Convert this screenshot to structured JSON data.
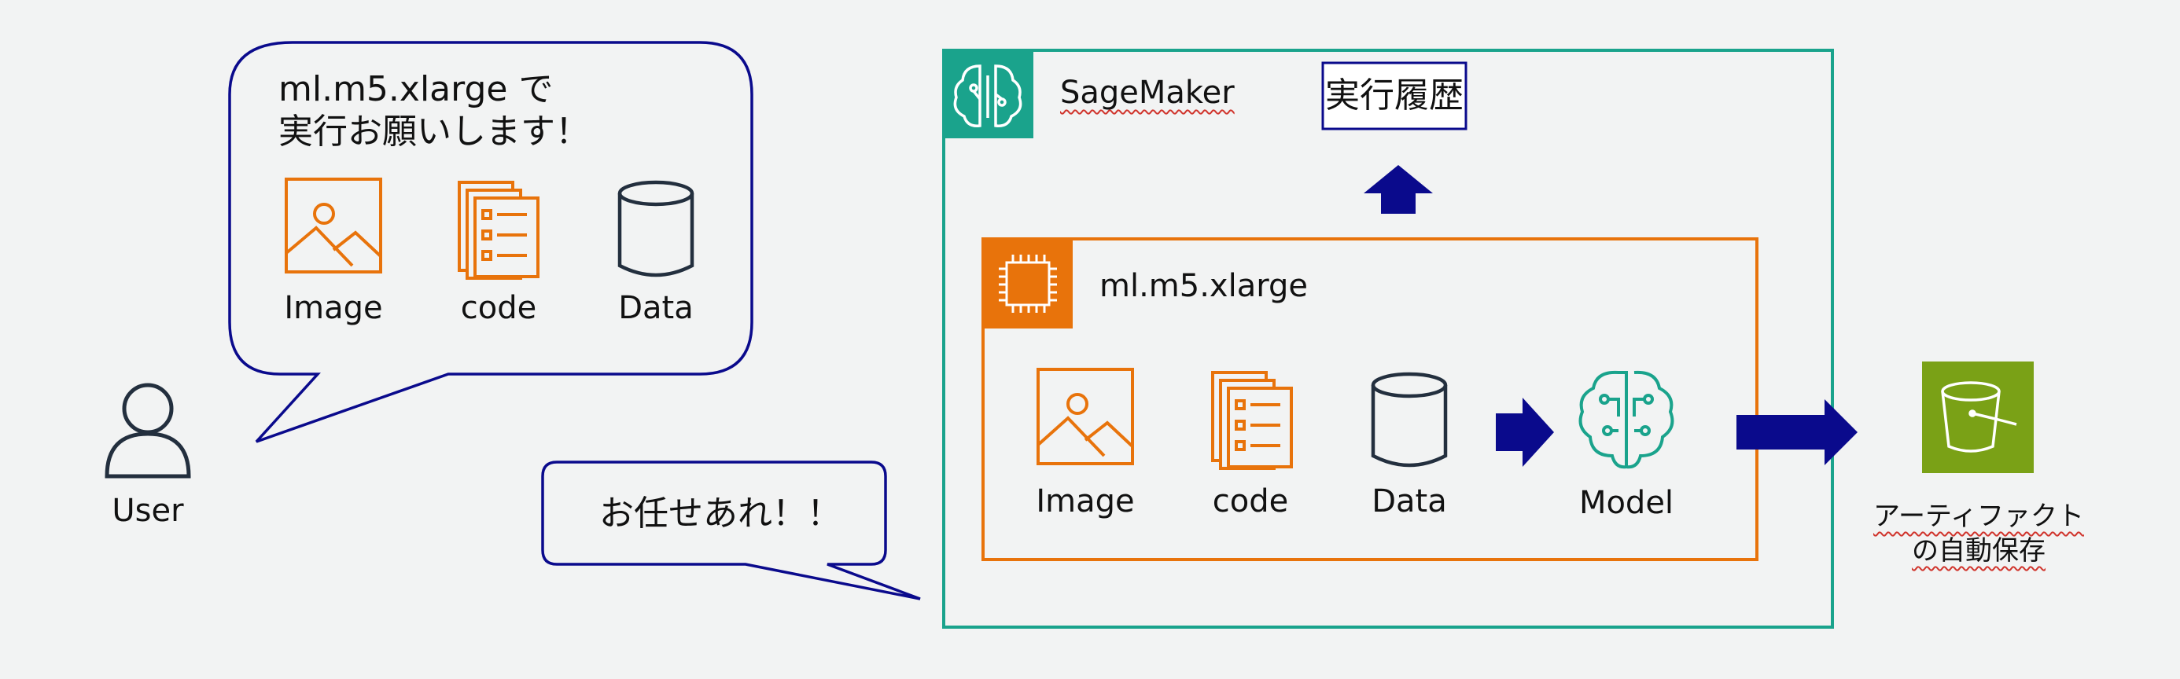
{
  "speech_user": {
    "line1": "ml.m5.xlarge で",
    "line2": "実行お願いします！"
  },
  "speech_reply": {
    "text": "お任せあれ！！"
  },
  "user": {
    "label": "User"
  },
  "left_items": {
    "image": "Image",
    "code": "code",
    "data": "Data"
  },
  "sagemaker": {
    "title": "SageMaker",
    "history": "実行履歴"
  },
  "instance": {
    "title": "ml.m5.xlarge",
    "image": "Image",
    "code": "code",
    "data": "Data",
    "model": "Model"
  },
  "artifact": {
    "line1": "アーティファクト",
    "line2": "の自動保存"
  },
  "colors": {
    "navy": "#0a0a8c",
    "teal": "#1aa38c",
    "orange": "#e8730b",
    "s3_green": "#7aa116",
    "background": "#f2f3f3"
  },
  "icons": [
    "user-icon",
    "image-icon",
    "code-document-icon",
    "database-icon",
    "sagemaker-icon",
    "ec2-instance-icon",
    "model-brain-icon",
    "s3-bucket-icon",
    "arrow-icon"
  ]
}
